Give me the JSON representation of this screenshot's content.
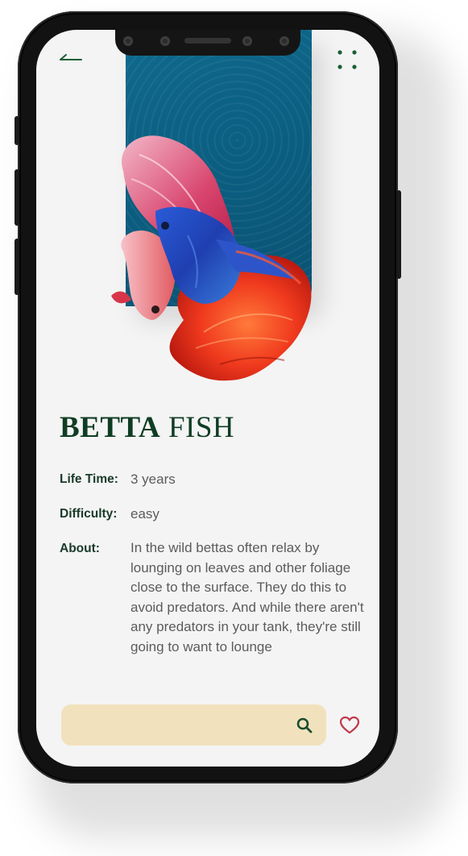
{
  "header": {
    "back_icon": "back-arrow-icon",
    "menu_icon": "grid-dots-icon"
  },
  "product": {
    "title_bold": "BETTA",
    "title_light": " FISH",
    "image": "betta-fish-image"
  },
  "details": {
    "lifetime_label": "Life Time:",
    "lifetime_value": "3 years",
    "difficulty_label": "Difficulty:",
    "difficulty_value": "easy",
    "about_label": "About:",
    "about_value": "In the wild bettas often relax by lounging on leaves and other foliage close to the surface. They do this to avoid predators. And while there aren't any predators in your tank, they're still going to want to lounge"
  },
  "footer": {
    "search_placeholder": "",
    "search_icon": "search-icon",
    "favorite_icon": "heart-icon"
  },
  "colors": {
    "title": "#0f3d23",
    "panel": "#0b5e80",
    "search_bg": "#f1e2bd",
    "heart": "#c0394b",
    "text": "#5b5b5b"
  }
}
